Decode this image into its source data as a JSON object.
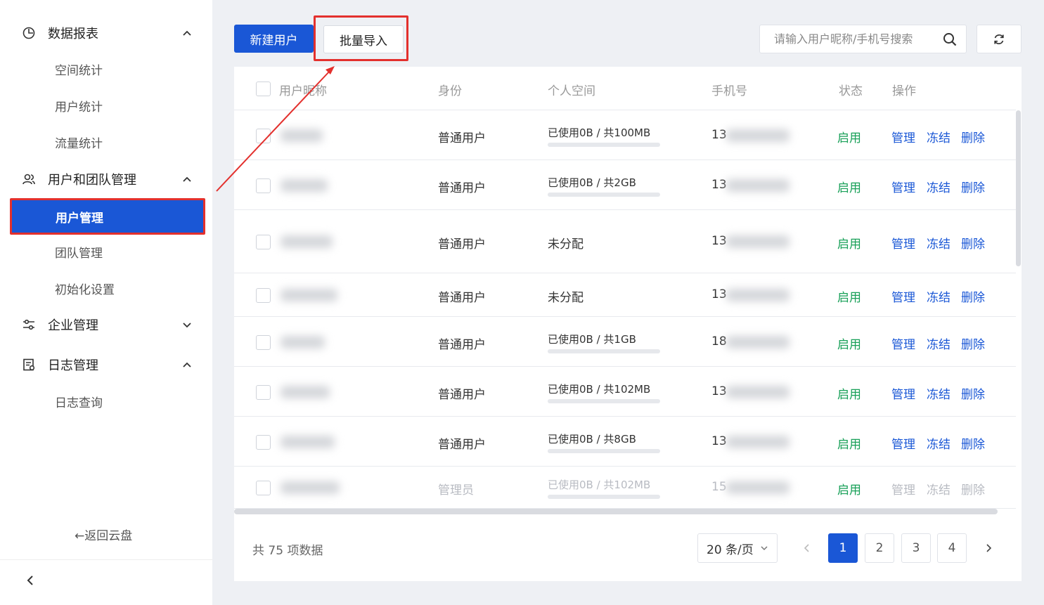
{
  "sidebar": {
    "groups": [
      {
        "label": "数据报表",
        "items": [
          "空间统计",
          "用户统计",
          "流量统计"
        ]
      },
      {
        "label": "用户和团队管理",
        "items": [
          "用户管理",
          "团队管理",
          "初始化设置"
        ]
      },
      {
        "label": "企业管理"
      },
      {
        "label": "日志管理",
        "items": [
          "日志查询"
        ]
      }
    ],
    "back_label": "←返回云盘"
  },
  "toolbar": {
    "new_user": "新建用户",
    "batch_import": "批量导入",
    "search_placeholder": "请输入用户昵称/手机号搜索"
  },
  "table": {
    "headers": {
      "nickname": "用户昵称",
      "role": "身份",
      "space": "个人空间",
      "phone": "手机号",
      "status": "状态",
      "actions": "操作"
    },
    "rows": [
      {
        "role": "普通用户",
        "space": "已使用0B / 共100MB",
        "phone_prefix": "13",
        "status": "启用",
        "usage": 0
      },
      {
        "role": "普通用户",
        "space": "已使用0B / 共2GB",
        "phone_prefix": "13",
        "status": "启用",
        "usage": 0
      },
      {
        "role": "普通用户",
        "space": "未分配",
        "phone_prefix": "13",
        "status": "启用"
      },
      {
        "role": "普通用户",
        "space": "未分配",
        "phone_prefix": "13",
        "status": "启用"
      },
      {
        "role": "普通用户",
        "space": "已使用0B / 共1GB",
        "phone_prefix": "18",
        "status": "启用",
        "usage": 0
      },
      {
        "role": "普通用户",
        "space": "已使用0B / 共102MB",
        "phone_prefix": "13",
        "status": "启用",
        "usage": 0
      },
      {
        "role": "普通用户",
        "space": "已使用0B / 共8GB",
        "phone_prefix": "13",
        "status": "启用",
        "usage": 0
      },
      {
        "role": "管理员",
        "space": "已使用0B / 共102MB",
        "phone_prefix": "15",
        "status": "启用",
        "usage": 0
      }
    ],
    "action_labels": {
      "manage": "管理",
      "freeze": "冻结",
      "delete": "删除"
    }
  },
  "footer": {
    "total": "共 75 项数据",
    "page_size": "20 条/页",
    "pages": [
      "1",
      "2",
      "3",
      "4"
    ],
    "current_page": "1"
  },
  "colors": {
    "primary": "#1a57d6",
    "highlight": "#e3302d",
    "status_enabled": "#18a058"
  }
}
